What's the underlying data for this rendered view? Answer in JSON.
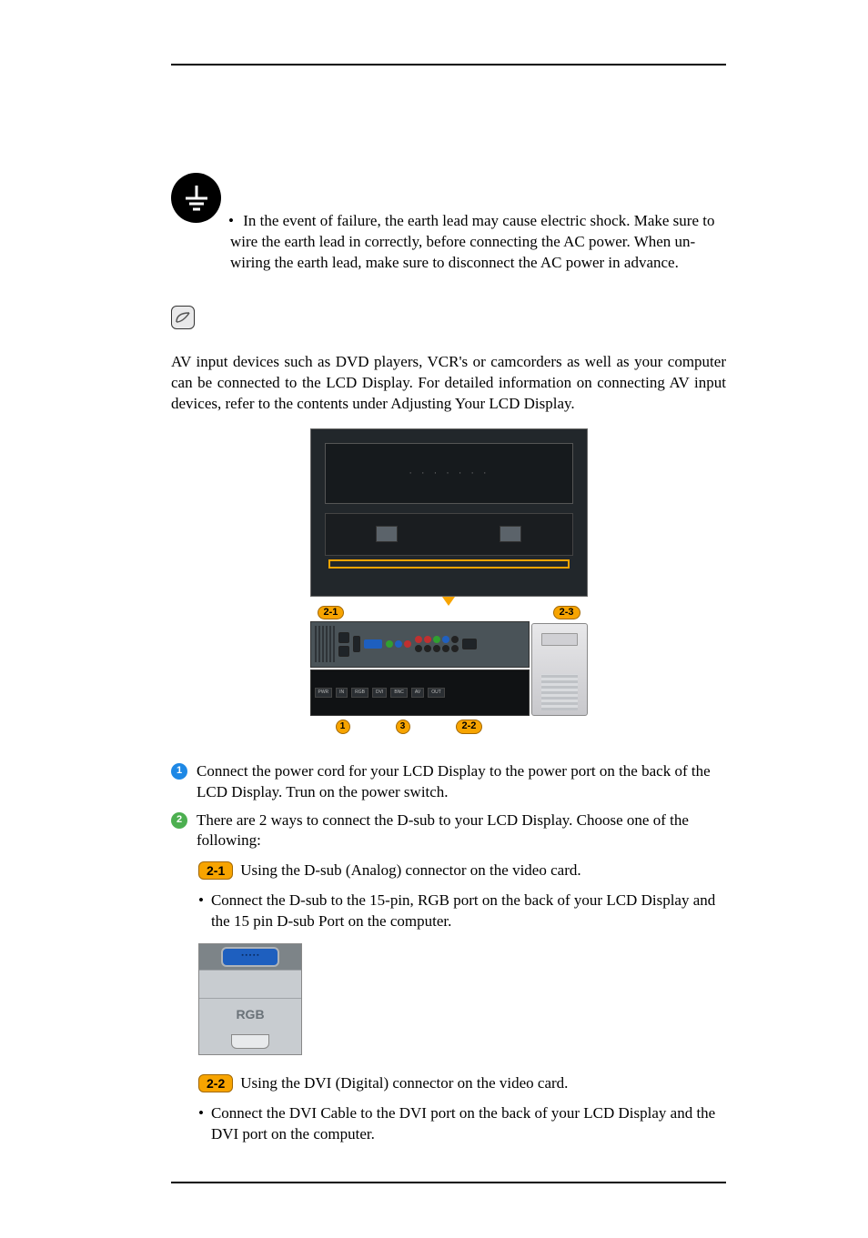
{
  "warning": {
    "bullet": "•",
    "text": "In the event of failure, the earth lead may cause electric shock. Make sure to wire the earth lead in correctly, before connecting the AC power. When un-wiring the earth lead, make sure to disconnect the AC power in advance."
  },
  "intro": "AV input devices such as DVD players, VCR's or camcorders as well as your computer can be connected to the LCD Display. For detailed information on connecting AV input devices, refer to the contents under Adjusting Your LCD Display.",
  "diagram": {
    "callouts": {
      "tl": "2-1",
      "tr": "2-3",
      "bl1": "1",
      "bl2": "3",
      "br": "2-2"
    }
  },
  "steps": {
    "s1": {
      "num": "1",
      "text": "Connect the power cord for your LCD Display to the power port on the back of the LCD Display. Trun on the power switch."
    },
    "s2": {
      "num": "2",
      "text": "There are 2 ways to connect the D-sub to your LCD Display. Choose one of the following:"
    },
    "s21": {
      "pill": "2-1",
      "text": "Using the D-sub (Analog) connector on the video card."
    },
    "s21b": {
      "dot": "•",
      "text": "Connect the D-sub to the 15-pin, RGB port on the back of your LCD Display and the 15 pin D-sub Port on the computer."
    },
    "rgb_label": "RGB",
    "s22": {
      "pill": "2-2",
      "text": "Using the DVI (Digital) connector on the video card."
    },
    "s22b": {
      "dot": "•",
      "text": "Connect the DVI Cable to the DVI port on the back of your LCD Display and the DVI port on the computer."
    }
  }
}
